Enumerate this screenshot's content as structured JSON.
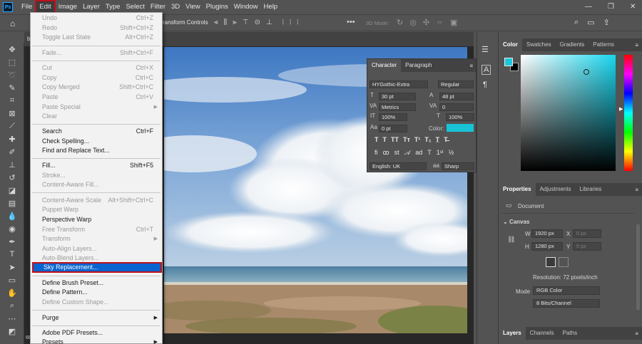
{
  "menubar": {
    "logo": "Ps",
    "items": [
      "File",
      "Edit",
      "Image",
      "Layer",
      "Type",
      "Select",
      "Filter",
      "3D",
      "View",
      "Plugins",
      "Window",
      "Help"
    ]
  },
  "options_bar": {
    "transform_controls": "ransform Controls",
    "mode_3d": "3D Mode:"
  },
  "doc": {
    "tab_letter": "b",
    "zoom_fragment": "66"
  },
  "edit_menu": {
    "items": [
      {
        "label": "Undo",
        "shortcut": "Ctrl+Z",
        "disabled": true
      },
      {
        "label": "Redo",
        "shortcut": "Shift+Ctrl+Z",
        "disabled": true
      },
      {
        "label": "Toggle Last State",
        "shortcut": "Alt+Ctrl+Z",
        "disabled": true
      },
      {
        "label": "Fade...",
        "shortcut": "Shift+Ctrl+F",
        "disabled": true
      },
      {
        "label": "Cut",
        "shortcut": "Ctrl+X",
        "disabled": true
      },
      {
        "label": "Copy",
        "shortcut": "Ctrl+C",
        "disabled": true
      },
      {
        "label": "Copy Merged",
        "shortcut": "Shift+Ctrl+C",
        "disabled": true
      },
      {
        "label": "Paste",
        "shortcut": "Ctrl+V",
        "disabled": true
      },
      {
        "label": "Paste Special",
        "shortcut": "",
        "disabled": true
      },
      {
        "label": "Clear",
        "shortcut": "",
        "disabled": true
      },
      {
        "label": "Search",
        "shortcut": "Ctrl+F",
        "disabled": false
      },
      {
        "label": "Check Spelling...",
        "shortcut": "",
        "disabled": false
      },
      {
        "label": "Find and Replace Text...",
        "shortcut": "",
        "disabled": false
      },
      {
        "label": "Fill...",
        "shortcut": "Shift+F5",
        "disabled": false
      },
      {
        "label": "Stroke...",
        "shortcut": "",
        "disabled": true
      },
      {
        "label": "Content-Aware Fill...",
        "shortcut": "",
        "disabled": true
      },
      {
        "label": "Content-Aware Scale",
        "shortcut": "Alt+Shift+Ctrl+C",
        "disabled": true
      },
      {
        "label": "Puppet Warp",
        "shortcut": "",
        "disabled": true
      },
      {
        "label": "Perspective Warp",
        "shortcut": "",
        "disabled": false
      },
      {
        "label": "Free Transform",
        "shortcut": "Ctrl+T",
        "disabled": true
      },
      {
        "label": "Transform",
        "shortcut": "",
        "disabled": true
      },
      {
        "label": "Auto-Align Layers...",
        "shortcut": "",
        "disabled": true
      },
      {
        "label": "Auto-Blend Layers...",
        "shortcut": "",
        "disabled": true
      },
      {
        "label": "Sky Replacement...",
        "shortcut": "",
        "disabled": false
      },
      {
        "label": "Define Brush Preset...",
        "shortcut": "",
        "disabled": false
      },
      {
        "label": "Define Pattern...",
        "shortcut": "",
        "disabled": false
      },
      {
        "label": "Define Custom Shape...",
        "shortcut": "",
        "disabled": true
      },
      {
        "label": "Purge",
        "shortcut": "",
        "disabled": false
      },
      {
        "label": "Adobe PDF Presets...",
        "shortcut": "",
        "disabled": false
      },
      {
        "label": "Presets",
        "shortcut": "",
        "disabled": false
      }
    ]
  },
  "character_panel": {
    "tabs": [
      "Character",
      "Paragraph"
    ],
    "font_family": "HYGothic-Extra",
    "font_style": "Regular",
    "font_size": "30 pt",
    "leading": "48 pt",
    "kerning": "Metrics",
    "tracking": "0",
    "vertical_scale": "100%",
    "horizontal_scale": "100%",
    "baseline_shift": "0 pt",
    "color_label": "Color:",
    "color": "#19c3d6",
    "language": "English: UK",
    "antialias": "Sharp"
  },
  "color_panel": {
    "tabs": [
      "Color",
      "Swatches",
      "Gradients",
      "Patterns"
    ],
    "foreground": "#1bc7dc",
    "background": "#000000"
  },
  "properties_panel": {
    "tabs": [
      "Properties",
      "Adjustments",
      "Libraries"
    ],
    "doc_label": "Document",
    "canvas_label": "Canvas",
    "w_label": "W",
    "w_value": "1920 px",
    "h_label": "H",
    "h_value": "1280 px",
    "x_label": "X",
    "x_value": "0 px",
    "y_label": "Y",
    "y_value": "0 px",
    "resolution": "Resolution: 72 pixels/inch",
    "mode_label": "Mode",
    "mode_value": "RGB Color",
    "bits_value": "8 Bits/Channel"
  },
  "layers_panel": {
    "tabs": [
      "Layers",
      "Channels",
      "Paths"
    ]
  }
}
